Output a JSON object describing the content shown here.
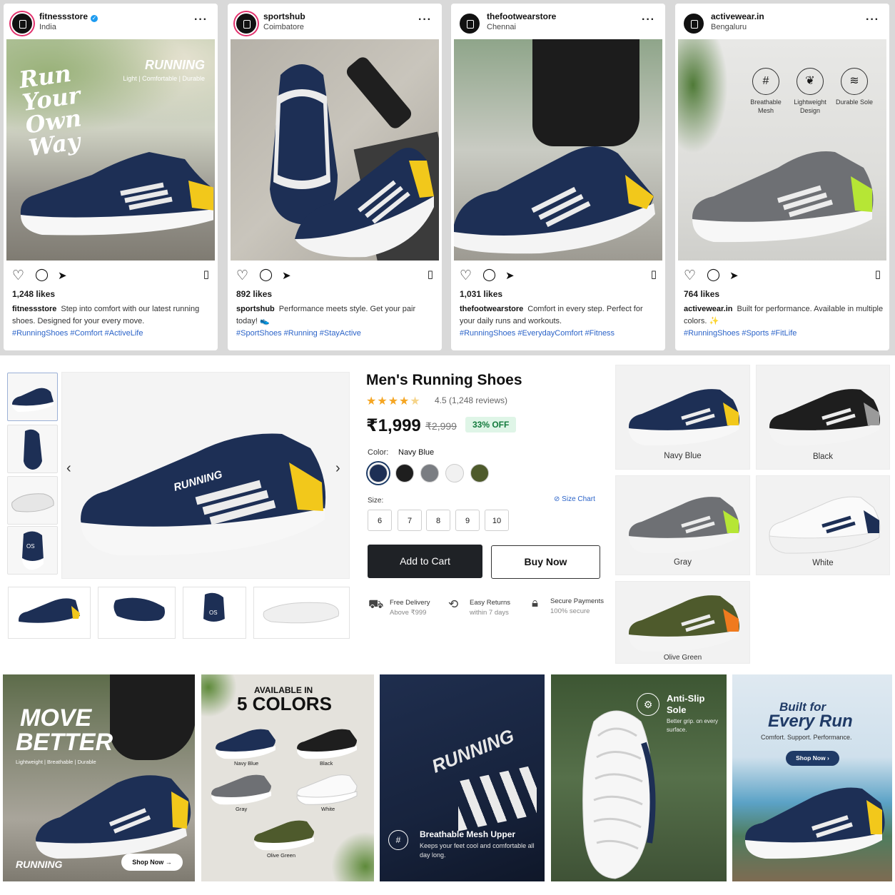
{
  "posts": [
    {
      "user": "fitnessstore",
      "verified": true,
      "location": "India",
      "likes": "1,248 likes",
      "caption": "Step into comfort with our latest running shoes. Designed for your every move.",
      "tags": "#RunningShoes #Comfort #ActiveLife",
      "overlay": {
        "script": "Run Your Own Way",
        "brand": "RUNNING",
        "sub": "Light | Comfortable | Durable"
      }
    },
    {
      "user": "sportshub",
      "location": "Coimbatore",
      "likes": "892 likes",
      "caption": "Performance meets style. Get your pair today! 👟",
      "tags": "#SportShoes #Running #StayActive"
    },
    {
      "user": "thefootwearstore",
      "location": "Chennai",
      "likes": "1,031 likes",
      "caption": "Comfort in every step. Perfect for your daily runs and workouts.",
      "tags": "#RunningShoes #EverydayComfort #Fitness"
    },
    {
      "user": "activewear.in",
      "location": "Bengaluru",
      "likes": "764 likes",
      "caption": "Built for performance. Available in multiple colors. ✨",
      "tags": "#RunningShoes #Sports #FitLife",
      "features": [
        "Breathable Mesh",
        "Lightweight Design",
        "Durable Sole"
      ]
    }
  ],
  "product": {
    "title": "Men's Running Shoes",
    "rating_text": "4.5 (1,248 reviews)",
    "rating": 4.5,
    "price": "₹1,999",
    "mrp": "₹2,999",
    "discount": "33% OFF",
    "color_label": "Color:",
    "color_value": "Navy Blue",
    "colors": [
      "#1d2f55",
      "#1e1e1e",
      "#7a7d82",
      "#f1f1f1",
      "#4e5a2c"
    ],
    "size_label": "Size:",
    "size_chart": "Size Chart",
    "sizes": [
      "6",
      "7",
      "8",
      "9",
      "10"
    ],
    "cart": "Add to Cart",
    "buy": "Buy Now",
    "features": [
      {
        "title": "Free Delivery",
        "sub": "Above ₹999",
        "icon": "truck-icon"
      },
      {
        "title": "Easy Returns",
        "sub": "within 7 days",
        "icon": "returns-icon"
      },
      {
        "title": "Secure Payments",
        "sub": "100% secure",
        "icon": "lock-icon"
      }
    ]
  },
  "variants": [
    {
      "name": "Navy Blue",
      "color": "#1d2f55",
      "accent": "#f2c81b"
    },
    {
      "name": "Black",
      "color": "#1e1e1e",
      "accent": "#9a9a9a"
    },
    {
      "name": "Gray",
      "color": "#6e7074",
      "accent": "#b6e635"
    },
    {
      "name": "White",
      "color": "#f4f4f4",
      "accent": "#1d2f55"
    },
    {
      "name": "Olive Green",
      "color": "#4e5a2c",
      "accent": "#f07a1e"
    }
  ],
  "banners": {
    "b1": {
      "title1": "MOVE",
      "title2": "BETTER",
      "sub": "Lightweight | Breathable | Durable",
      "brand": "RUNNING",
      "cta": "Shop Now"
    },
    "b2": {
      "top": "AVAILABLE IN",
      "big": "5 COLORS",
      "labels": [
        "Navy Blue",
        "Black",
        "Gray",
        "White",
        "Olive Green"
      ]
    },
    "b3": {
      "brand": "RUNNING",
      "title": "Breathable Mesh Upper",
      "sub": "Keeps your feet cool and comfortable all day long."
    },
    "b4": {
      "title1": "Anti-Slip",
      "title2": "Sole",
      "sub": "Better grip. on every surface."
    },
    "b5": {
      "title1": "Built for",
      "title2": "Every Run",
      "sub": "Comfort. Support. Performance.",
      "cta": "Shop Now"
    }
  },
  "shoe_text": "RUNNING"
}
